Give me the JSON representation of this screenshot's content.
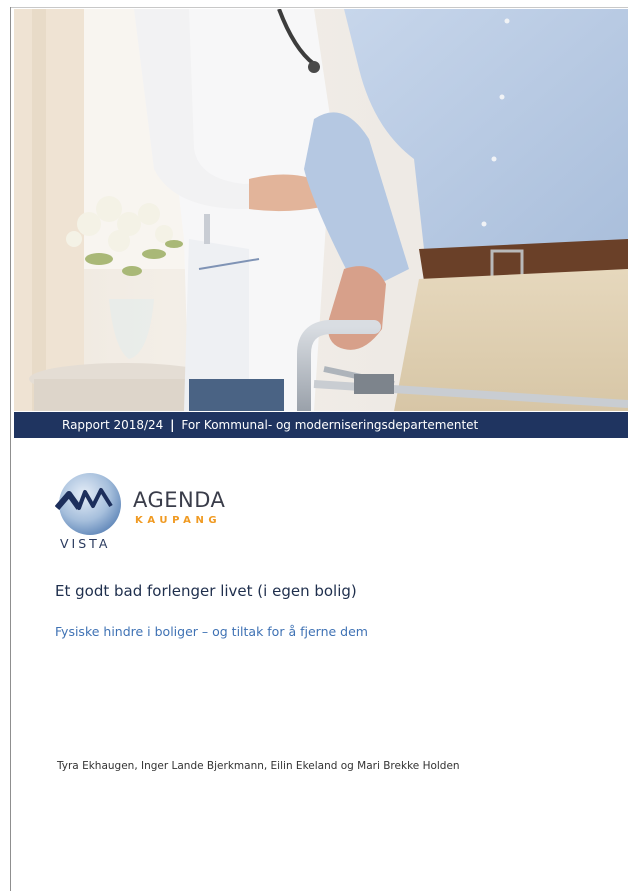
{
  "cover_photo": {
    "description_icon": "nurse-assisting-elderly-man-with-walker-photo"
  },
  "banner": {
    "report_number": "Rapport 2018/24",
    "separator": "|",
    "client": "For Kommunal- og moderniseringsdepartementet"
  },
  "logo": {
    "vista": "VISTA",
    "agenda": "AGENDA",
    "kaupang": "KAUPANG"
  },
  "title": "Et godt bad forlenger livet (i egen bolig)",
  "subtitle": "Fysiske hindre i boliger – og tiltak for å fjerne dem",
  "authors": "Tyra Ekhaugen, Inger Lande Bjerkmann, Eilin Ekeland og Mari Brekke Holden",
  "colors": {
    "banner": "#1f3460",
    "title": "#1f2f4d",
    "subtitle": "#3f72b4",
    "kaupang_orange": "#f09a22"
  }
}
